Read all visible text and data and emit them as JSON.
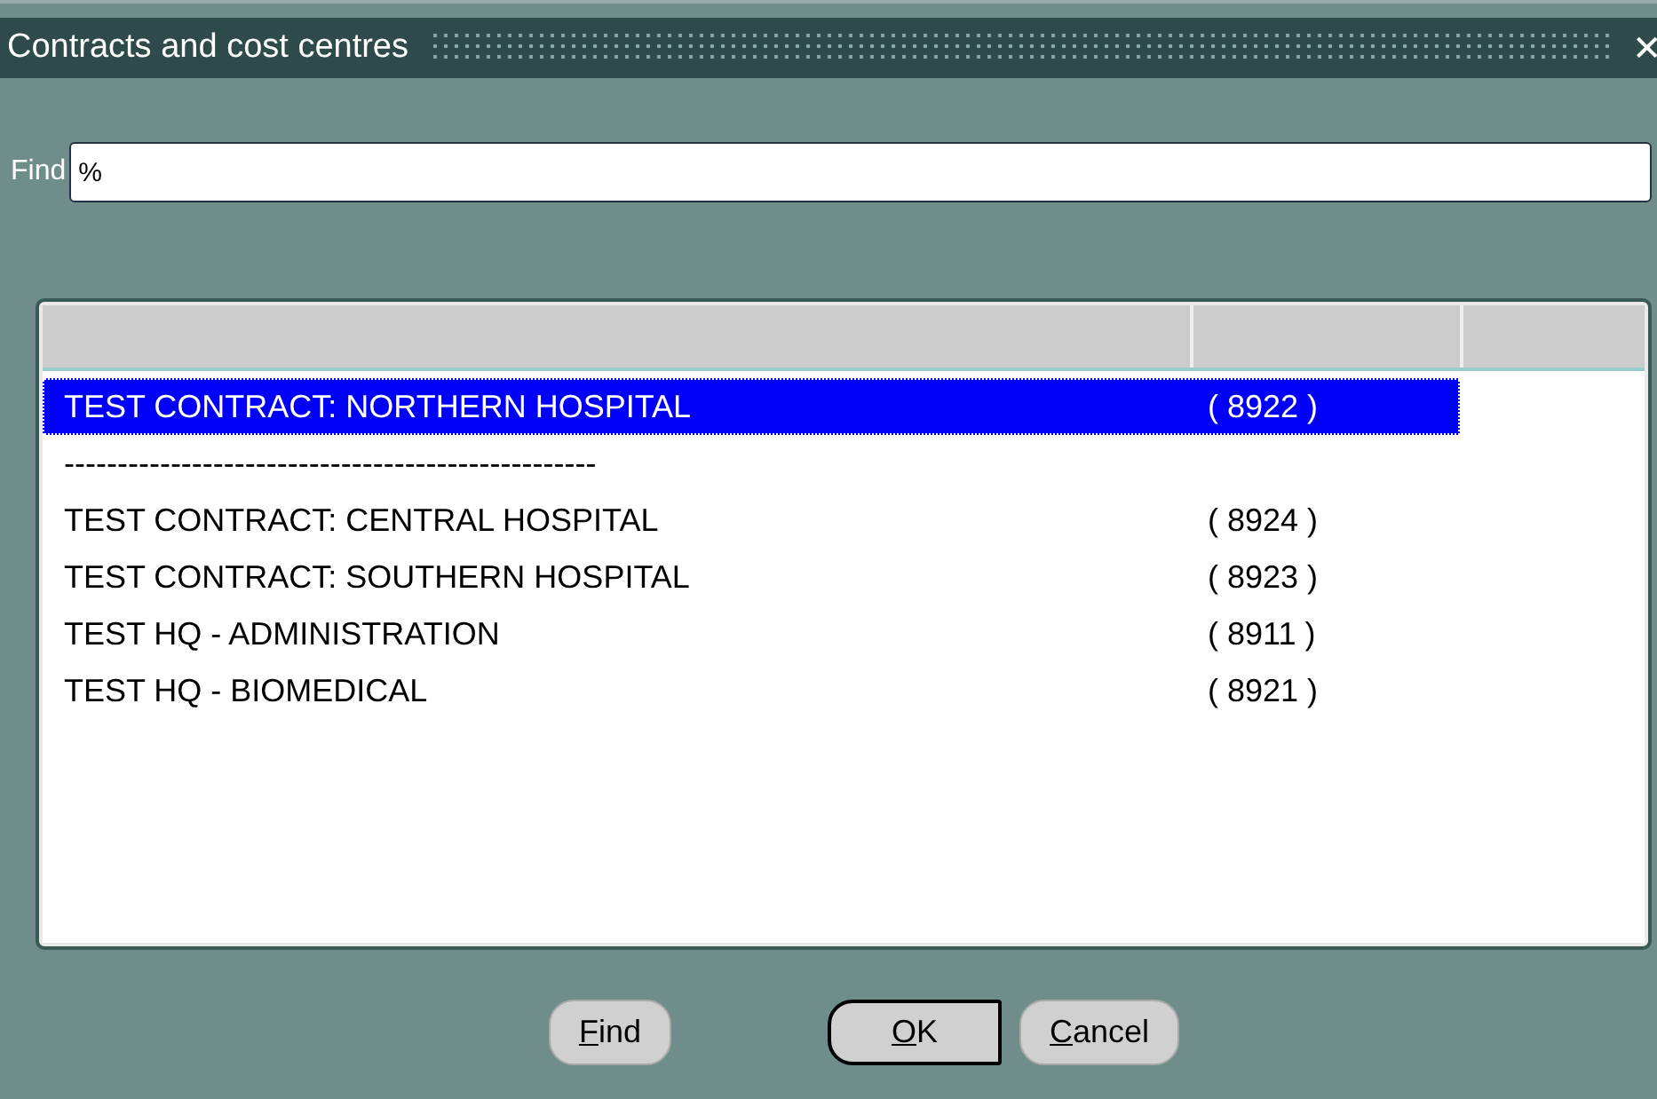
{
  "window": {
    "title": "Contracts and cost centres",
    "close": "✕"
  },
  "find": {
    "label": "Find",
    "value": "%"
  },
  "table": {
    "rows": [
      {
        "kind": "item",
        "name": "TEST CONTRACT: NORTHERN HOSPITAL",
        "code": "( 8922 )",
        "selected": true
      },
      {
        "kind": "separator",
        "name": "--------------------------------------------------",
        "selected": false
      },
      {
        "kind": "item",
        "name": "TEST CONTRACT: CENTRAL HOSPITAL",
        "code": "( 8924 )",
        "selected": false
      },
      {
        "kind": "item",
        "name": "TEST CONTRACT: SOUTHERN HOSPITAL",
        "code": "( 8923 )",
        "selected": false
      },
      {
        "kind": "item",
        "name": "TEST HQ - ADMINISTRATION",
        "code": "( 8911 )",
        "selected": false
      },
      {
        "kind": "item",
        "name": "TEST HQ - BIOMEDICAL",
        "code": "( 8921 )",
        "selected": false
      }
    ]
  },
  "buttons": [
    {
      "label": "Find",
      "default": false
    },
    {
      "label": "OK",
      "default": true
    },
    {
      "label": "Cancel",
      "default": false
    }
  ]
}
